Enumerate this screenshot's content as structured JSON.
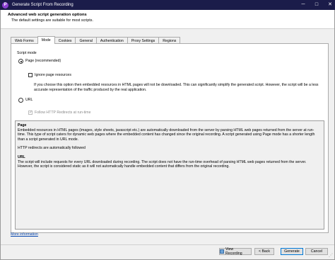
{
  "window": {
    "title": "Generate Script From Recording",
    "app_icon_letter": "P",
    "controls": {
      "minimize": "─",
      "maximize": "□",
      "close": "✕"
    }
  },
  "header": {
    "title": "Advanced web script generation options",
    "subtitle": "The default settings are suitable for most scripts."
  },
  "tabs": [
    {
      "label": "Web Forms",
      "active": false
    },
    {
      "label": "Mode",
      "active": true
    },
    {
      "label": "Cookies",
      "active": false
    },
    {
      "label": "General",
      "active": false
    },
    {
      "label": "Authentication",
      "active": false
    },
    {
      "label": "Proxy Settings",
      "active": false
    },
    {
      "label": "Regions",
      "active": false
    }
  ],
  "mode": {
    "group_label": "Script mode",
    "page_option": "Page (recommended)",
    "page_selected": true,
    "ignore_resources_label": "Ignore page resources",
    "ignore_resources_checked": false,
    "description": "If you choose this option then embedded resources in HTML pages will not be downloaded. This can significantly simplify the generated script. However, the script will be a less accurate representation of the traffic produced by the real application.",
    "url_option": "URL",
    "url_selected": false,
    "follow_redirects_label": "Follow HTTP Redirects at run-time",
    "follow_redirects_checked": true
  },
  "info": {
    "page_heading": "Page",
    "page_text": "Embedded resources in HTML pages (images, style sheets, javascript etc.) are automatically downloaded from the server by parsing HTML web pages returned from the server at run-time. This type of script caters for dynamic web pages where the embedded content has changed since the original recording.  A script generated using Page mode has a shorter length than a script generated in URL mode.",
    "redirects_text": "HTTP redirects are automatically followed",
    "url_heading": "URL",
    "url_text": "The script will include requests for every URL downloaded during recording. The script does not have the run-time overhead of parsing HTML web pages returned from the server. However, the script is considered static as it will not automatically handle embedded content that differs from the original recording."
  },
  "more_info_link": "More information",
  "buttons": {
    "view_recording": "View Recording",
    "back": "< Back",
    "generate": "Generate",
    "cancel": "Cancel"
  }
}
